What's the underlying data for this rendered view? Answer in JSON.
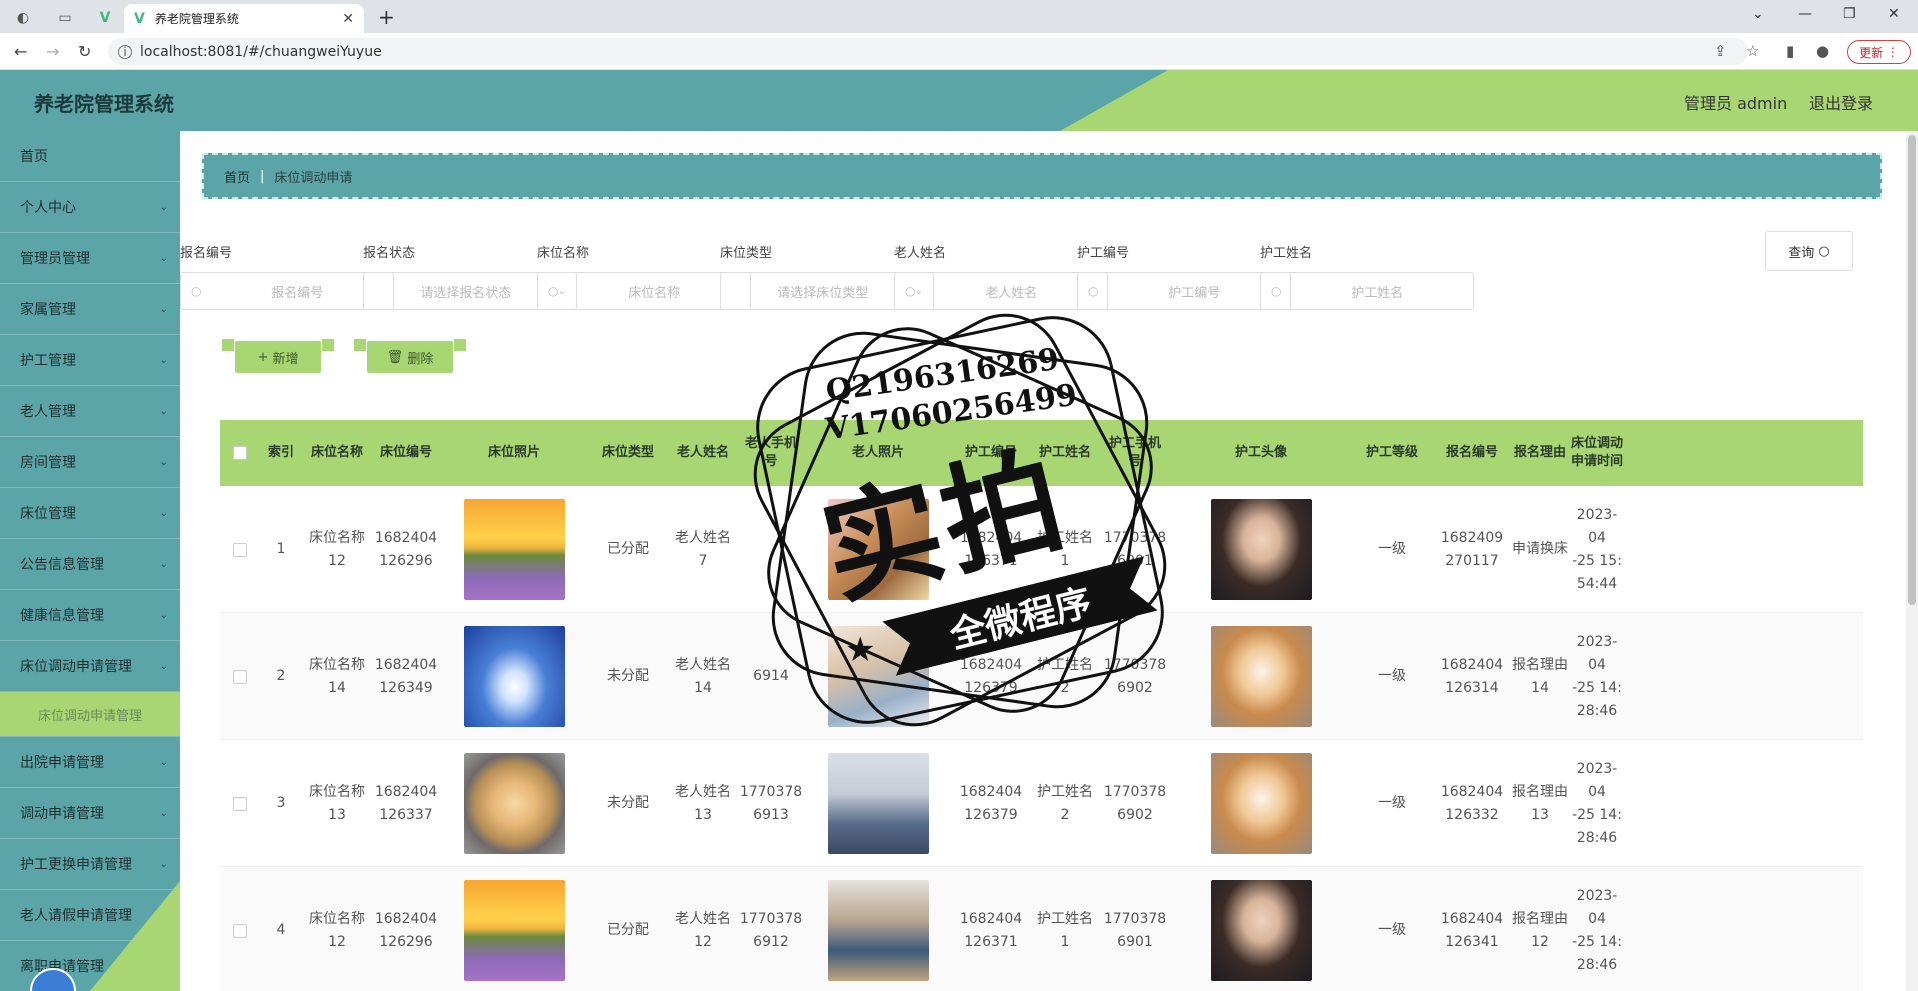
{
  "browser": {
    "tab_title": "养老院管理系统",
    "url": "localhost:8081/#/chuangweiYuyue",
    "update_label": "更新"
  },
  "header": {
    "title": "养老院管理系统",
    "user": "管理员 admin",
    "logout": "退出登录"
  },
  "sidebar": {
    "items": [
      {
        "label": "首页",
        "chev": false
      },
      {
        "label": "个人中心",
        "chev": true
      },
      {
        "label": "管理员管理",
        "chev": true
      },
      {
        "label": "家属管理",
        "chev": true
      },
      {
        "label": "护工管理",
        "chev": true
      },
      {
        "label": "老人管理",
        "chev": true
      },
      {
        "label": "房间管理",
        "chev": true
      },
      {
        "label": "床位管理",
        "chev": true
      },
      {
        "label": "公告信息管理",
        "chev": true
      },
      {
        "label": "健康信息管理",
        "chev": true
      },
      {
        "label": "床位调动申请管理",
        "chev": true
      }
    ],
    "sub_item": "床位调动申请管理",
    "items_after": [
      {
        "label": "出院申请管理"
      },
      {
        "label": "调动申请管理"
      },
      {
        "label": "护工更换申请管理"
      },
      {
        "label": "老人请假申请管理"
      },
      {
        "label": "离职申请管理"
      }
    ]
  },
  "breadcrumb": {
    "home": "首页",
    "current": "床位调动申请"
  },
  "filters": [
    {
      "label": "报名编号",
      "placeholder": "报名编号",
      "type": "input"
    },
    {
      "label": "报名状态",
      "placeholder": "请选择报名状态",
      "type": "select"
    },
    {
      "label": "床位名称",
      "placeholder": "床位名称",
      "type": "input"
    },
    {
      "label": "床位类型",
      "placeholder": "请选择床位类型",
      "type": "select"
    },
    {
      "label": "老人姓名",
      "placeholder": "老人姓名",
      "type": "input"
    },
    {
      "label": "护工编号",
      "placeholder": "护工编号",
      "type": "input"
    },
    {
      "label": "护工姓名",
      "placeholder": "护工姓名",
      "type": "input"
    }
  ],
  "query_label": "查询",
  "actions": {
    "add": "新增",
    "delete": "删除"
  },
  "table": {
    "headers": [
      "索引",
      "床位名称",
      "床位编号",
      "床位照片",
      "床位类型",
      "老人姓名",
      "老人手机号",
      "老人照片",
      "护工编号",
      "护工姓名",
      "护工手机号",
      "护工头像",
      "护工等级",
      "报名编号",
      "报名理由",
      "床位调动申请时间"
    ],
    "rows": [
      {
        "idx": "1",
        "bed_name": "床位名称12",
        "bed_no": "1682404126296",
        "bed_photo": "sunset",
        "bed_type": "已分配",
        "elder_name": "老人姓名7",
        "elder_phone": "",
        "elder_photo": "elder1",
        "nurse_no": "1682404126371",
        "nurse_name": "护工姓名1",
        "nurse_phone": "17703786901",
        "nurse_avatar": "man",
        "level": "一级",
        "reg_no": "1682409270117",
        "reason": "申请换床",
        "time": "2023-04-25 15:54:44"
      },
      {
        "idx": "2",
        "bed_name": "床位名称14",
        "bed_no": "1682404126349",
        "bed_photo": "sky",
        "bed_type": "未分配",
        "elder_name": "老人姓名14",
        "elder_phone": "6914",
        "elder_photo": "elder2",
        "nurse_no": "1682404126379",
        "nurse_name": "护工姓名2",
        "nurse_phone": "17703786902",
        "nurse_avatar": "dog",
        "level": "一级",
        "reg_no": "1682404126314",
        "reason": "报名理由14",
        "time": "2023-04-25 14:28:46"
      },
      {
        "idx": "3",
        "bed_name": "床位名称13",
        "bed_no": "1682404126337",
        "bed_photo": "desert",
        "bed_type": "未分配",
        "elder_name": "老人姓名13",
        "elder_phone": "17703786913",
        "elder_photo": "group",
        "nurse_no": "1682404126379",
        "nurse_name": "护工姓名2",
        "nurse_phone": "17703786902",
        "nurse_avatar": "dog",
        "level": "一级",
        "reg_no": "1682404126332",
        "reason": "报名理由13",
        "time": "2023-04-25 14:28:46"
      },
      {
        "idx": "4",
        "bed_name": "床位名称12",
        "bed_no": "1682404126296",
        "bed_photo": "sunset",
        "bed_type": "已分配",
        "elder_name": "老人姓名12",
        "elder_phone": "17703786912",
        "elder_photo": "table",
        "nurse_no": "1682404126371",
        "nurse_name": "护工姓名1",
        "nurse_phone": "17703786901",
        "nurse_avatar": "man",
        "level": "一级",
        "reg_no": "1682404126341",
        "reason": "报名理由12",
        "time": "2023-04-25 14:28:46"
      }
    ]
  },
  "watermark": {
    "line1": "Q2196316269",
    "line2": "V17060256499",
    "big": "实拍",
    "ribbon": "全微程序"
  }
}
